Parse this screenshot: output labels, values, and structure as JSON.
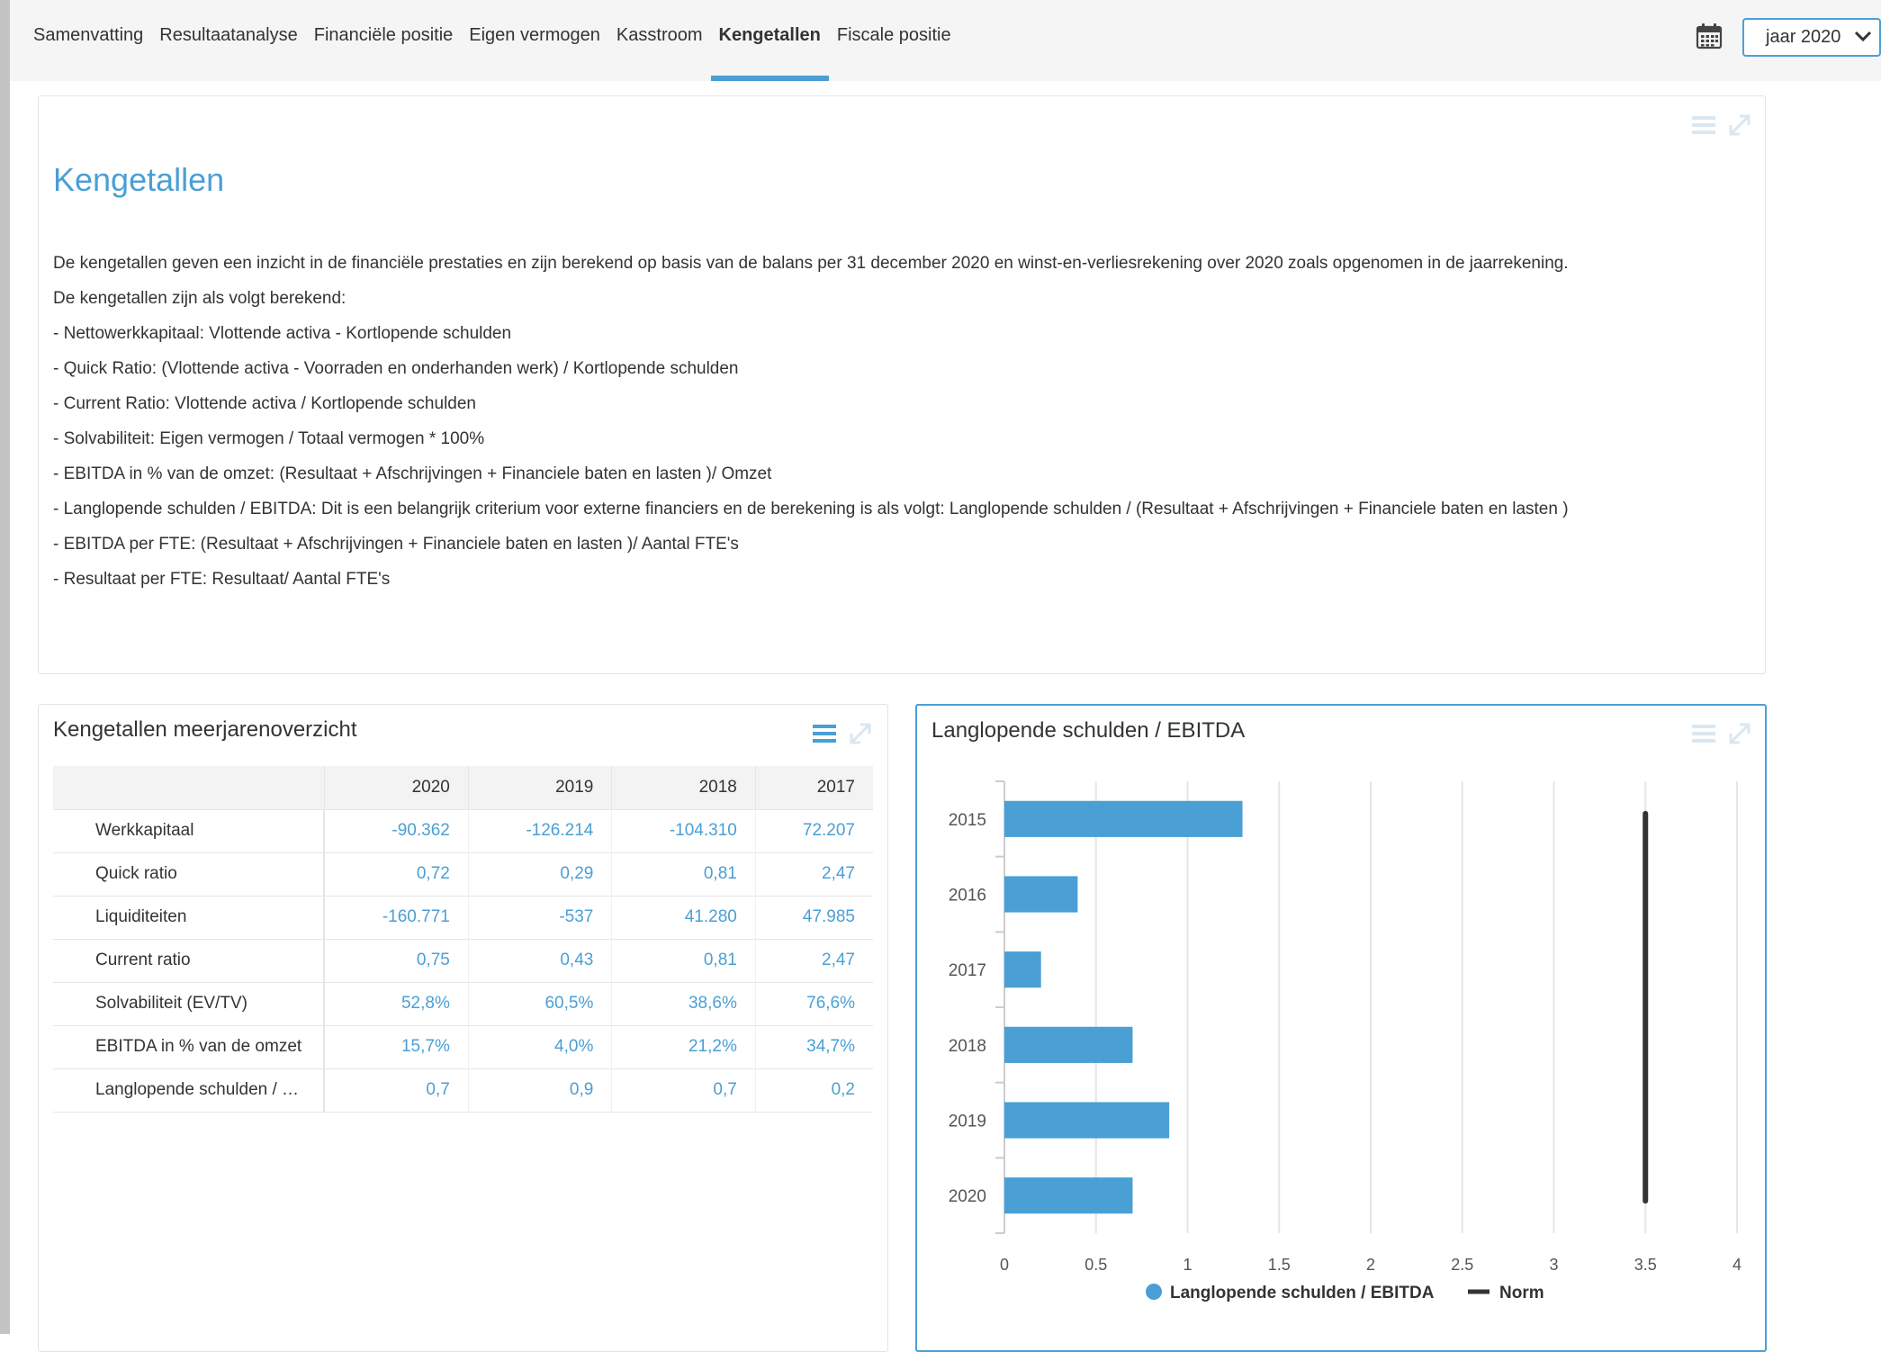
{
  "nav": {
    "tabs": [
      {
        "label": "Samenvatting"
      },
      {
        "label": "Resultaatanalyse"
      },
      {
        "label": "Financiële positie"
      },
      {
        "label": "Eigen vermogen"
      },
      {
        "label": "Kasstroom"
      },
      {
        "label": "Kengetallen"
      },
      {
        "label": "Fiscale positie"
      }
    ],
    "active_tab": "Kengetallen",
    "year_select": "jaar 2020"
  },
  "intro": {
    "title": "Kengetallen",
    "paragraphs": [
      "De kengetallen geven een inzicht in de financiële prestaties en zijn berekend op basis van de balans per 31 december 2020 en winst-en-verliesrekening over 2020 zoals opgenomen in de jaarrekening.",
      "De kengetallen zijn als volgt berekend:",
      "- Nettowerkkapitaal: Vlottende activa - Kortlopende schulden",
      "- Quick Ratio: (Vlottende activa - Voorraden en onderhanden werk) / Kortlopende schulden",
      "- Current Ratio: Vlottende activa / Kortlopende schulden",
      "- Solvabiliteit: Eigen vermogen / Totaal vermogen * 100%",
      "- EBITDA in % van de omzet: (Resultaat + Afschrijvingen + Financiele baten en lasten )/ Omzet",
      "- Langlopende schulden / EBITDA: Dit is een belangrijk criterium voor externe financiers en de berekening is als volgt: Langlopende schulden / (Resultaat + Afschrijvingen + Financiele baten en lasten )",
      "- EBITDA per FTE: (Resultaat + Afschrijvingen + Financiele baten en lasten )/ Aantal FTE's",
      "- Resultaat per FTE: Resultaat/ Aantal FTE's"
    ]
  },
  "overview": {
    "title": "Kengetallen meerjarenoverzicht",
    "columns": [
      "",
      "2020",
      "2019",
      "2018",
      "2017"
    ],
    "rows": [
      {
        "label": "Werkkapitaal",
        "values": [
          "-90.362",
          "-126.214",
          "-104.310",
          "72.207"
        ]
      },
      {
        "label": "Quick ratio",
        "values": [
          "0,72",
          "0,29",
          "0,81",
          "2,47"
        ]
      },
      {
        "label": "Liquiditeiten",
        "values": [
          "-160.771",
          "-537",
          "41.280",
          "47.985"
        ]
      },
      {
        "label": "Current ratio",
        "values": [
          "0,75",
          "0,43",
          "0,81",
          "2,47"
        ]
      },
      {
        "label": "Solvabiliteit (EV/TV)",
        "values": [
          "52,8%",
          "60,5%",
          "38,6%",
          "76,6%"
        ]
      },
      {
        "label": "EBITDA in % van de omzet",
        "values": [
          "15,7%",
          "4,0%",
          "21,2%",
          "34,7%"
        ]
      },
      {
        "label": "Langlopende schulden / …",
        "values": [
          "0,7",
          "0,9",
          "0,7",
          "0,2"
        ]
      }
    ]
  },
  "chart_panel": {
    "title": "Langlopende schulden / EBITDA"
  },
  "colors": {
    "accent": "#4a9fd5",
    "bar": "#4a9fd5",
    "norm": "#333333"
  },
  "icons": [
    "calendar-icon",
    "chevron-down-icon",
    "menu-icon",
    "expand-icon"
  ],
  "chart_data": {
    "type": "bar",
    "orientation": "horizontal",
    "title": "Langlopende schulden / EBITDA",
    "categories": [
      "2015",
      "2016",
      "2017",
      "2018",
      "2019",
      "2020"
    ],
    "series": [
      {
        "name": "Langlopende schulden / EBITDA",
        "values": [
          1.3,
          0.4,
          0.2,
          0.7,
          0.9,
          0.7
        ]
      },
      {
        "name": "Norm",
        "type": "line",
        "value": 3.5
      }
    ],
    "xlim": [
      0,
      4
    ],
    "xticks": [
      "0",
      "0.5",
      "1",
      "1.5",
      "2",
      "2.5",
      "3",
      "3.5",
      "4"
    ],
    "grid": true,
    "legend": "bottom-center"
  }
}
